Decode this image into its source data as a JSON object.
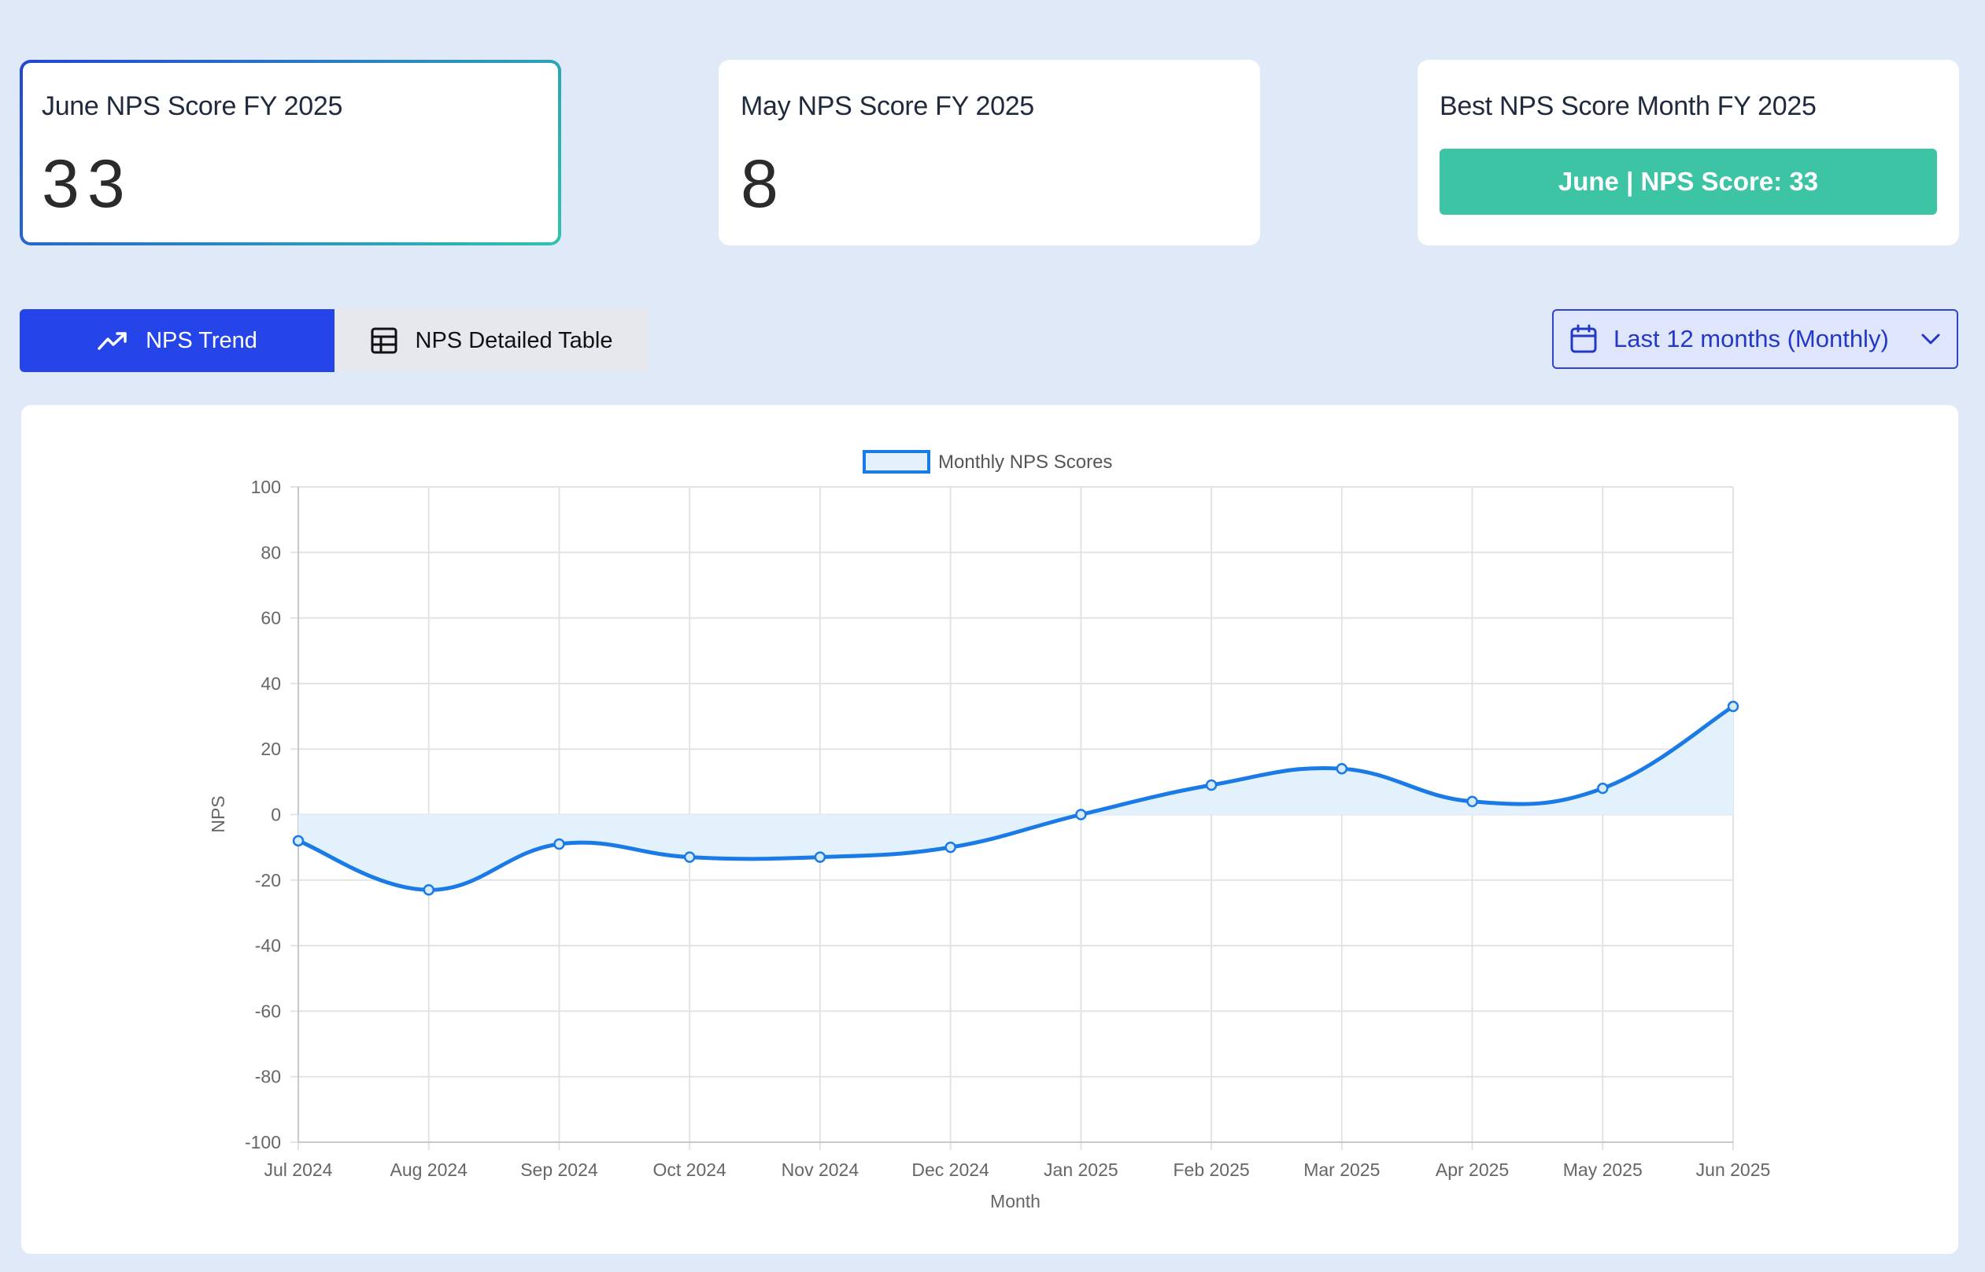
{
  "cards": {
    "june": {
      "title": "June NPS Score FY 2025",
      "value": "33"
    },
    "may": {
      "title": "May NPS Score FY 2025",
      "value": "8"
    },
    "best": {
      "title": "Best NPS Score Month FY 2025",
      "badge": "June | NPS Score: 33"
    }
  },
  "tabs": {
    "trend": {
      "label": "NPS Trend",
      "icon": "trending-up-icon",
      "active": true
    },
    "table": {
      "label": "NPS Detailed Table",
      "icon": "table-icon",
      "active": false
    }
  },
  "range_select": {
    "label": "Last 12 months (Monthly)",
    "icon": "calendar-icon"
  },
  "colors": {
    "accent": "#2545e8",
    "line": "#1a7ae6",
    "fill": "#e3f1fc",
    "badge": "#3cc4a4"
  },
  "chart_data": {
    "type": "line",
    "x": [
      "Jul 2024",
      "Aug 2024",
      "Sep 2024",
      "Oct 2024",
      "Nov 2024",
      "Dec 2024",
      "Jan 2025",
      "Feb 2025",
      "Mar 2025",
      "Apr 2025",
      "May 2025",
      "Jun 2025"
    ],
    "series": [
      {
        "name": "Monthly NPS Scores",
        "values": [
          -8,
          -23,
          -9,
          -13,
          -13,
          -10,
          0,
          9,
          14,
          4,
          8,
          33
        ]
      }
    ],
    "xlabel": "Month",
    "ylabel": "NPS",
    "ylim": [
      -100,
      100
    ],
    "yticks": [
      100,
      80,
      60,
      40,
      20,
      0,
      -20,
      -40,
      -60,
      -80,
      -100
    ],
    "grid": true,
    "legend": "top-center",
    "fill": "origin"
  }
}
